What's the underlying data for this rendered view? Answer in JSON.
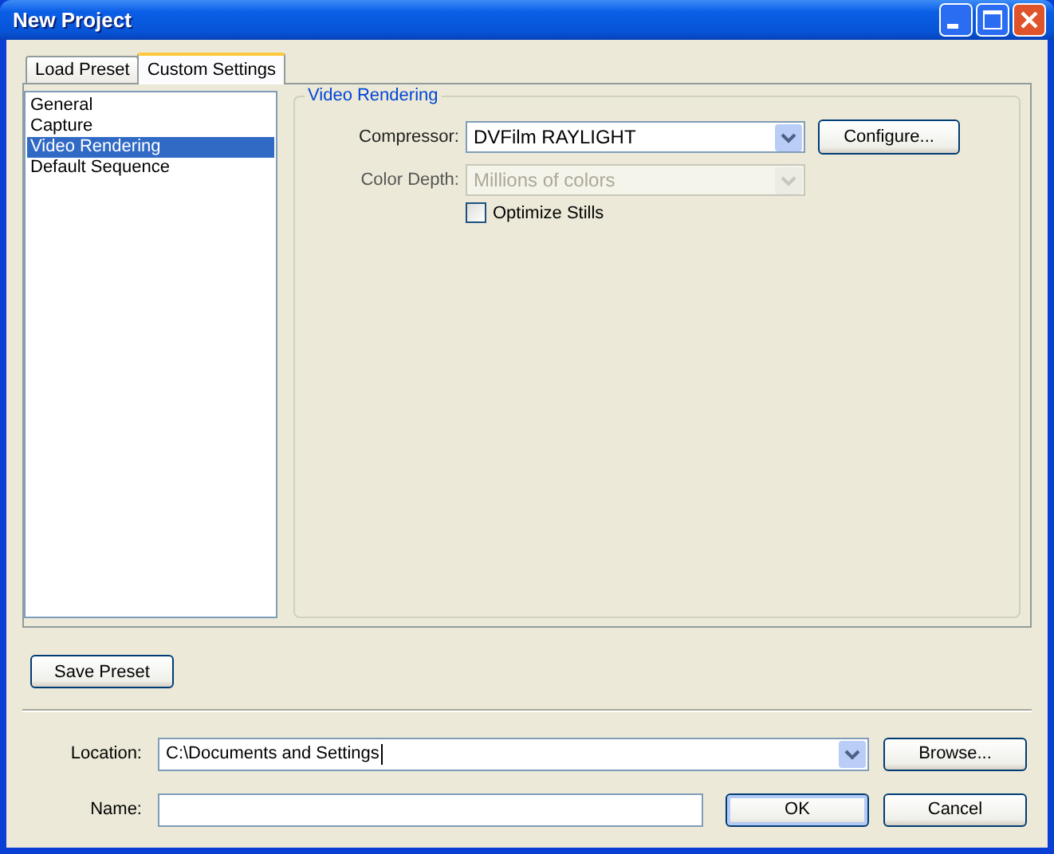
{
  "window": {
    "title": "New Project"
  },
  "tabs": [
    {
      "label": "Load Preset",
      "selected": false
    },
    {
      "label": "Custom Settings",
      "selected": true
    }
  ],
  "categories": [
    {
      "label": "General",
      "selected": false
    },
    {
      "label": "Capture",
      "selected": false
    },
    {
      "label": "Video Rendering",
      "selected": true
    },
    {
      "label": "Default Sequence",
      "selected": false
    }
  ],
  "group": {
    "title": "Video Rendering",
    "fields": [
      {
        "label": "Compressor:",
        "value": "DVFilm RAYLIGHT",
        "disabled": false,
        "button": "Configure..."
      },
      {
        "label": "Color Depth:",
        "value": "Millions of colors",
        "disabled": true
      }
    ],
    "checkbox": {
      "label": "Optimize Stills",
      "checked": false
    }
  },
  "save_preset": "Save Preset",
  "location": {
    "label": "Location:",
    "value": "C:\\Documents and Settings",
    "button": "Browse..."
  },
  "name": {
    "label": "Name:"
  },
  "buttons": [
    "OK",
    "Cancel"
  ]
}
